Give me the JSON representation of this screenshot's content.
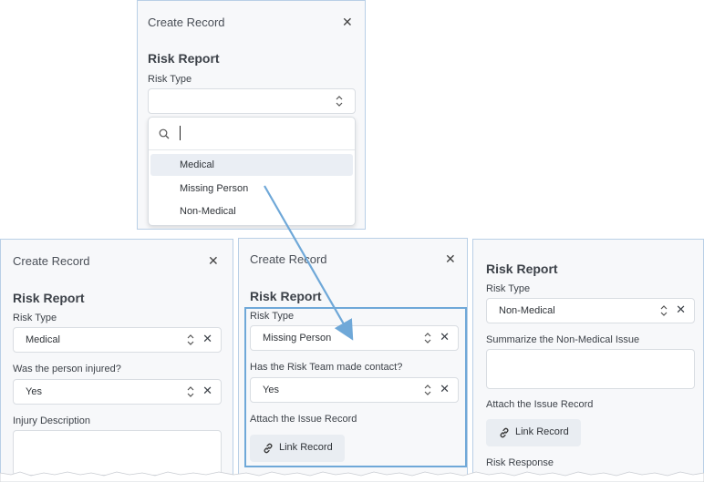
{
  "dialog_top": {
    "header_title": "Create Record",
    "form_title": "Risk Report",
    "risk_type_label": "Risk Type",
    "search_value": "",
    "options": [
      "Medical",
      "Missing Person",
      "Non-Medical"
    ]
  },
  "panel_left": {
    "header_title": "Create Record",
    "form_title": "Risk Report",
    "risk_type_label": "Risk Type",
    "risk_type_value": "Medical",
    "injured_label": "Was the person injured?",
    "injured_value": "Yes",
    "injury_desc_label": "Injury Description"
  },
  "panel_middle": {
    "header_title": "Create Record",
    "form_title": "Risk Report",
    "risk_type_label": "Risk Type",
    "risk_type_value": "Missing Person",
    "contact_label": "Has the Risk Team made contact?",
    "contact_value": "Yes",
    "attach_label": "Attach the Issue Record",
    "link_button": "Link Record"
  },
  "panel_right": {
    "form_title": "Risk Report",
    "risk_type_label": "Risk Type",
    "risk_type_value": "Non-Medical",
    "summary_label": "Summarize the Non-Medical Issue",
    "attach_label": "Attach the Issue Record",
    "link_button": "Link Record",
    "response_label": "Risk Response"
  },
  "colors": {
    "accent_blue": "#6fa8d8",
    "panel_border": "#b9cfe6",
    "selected_option_bg": "#eaeef4"
  }
}
